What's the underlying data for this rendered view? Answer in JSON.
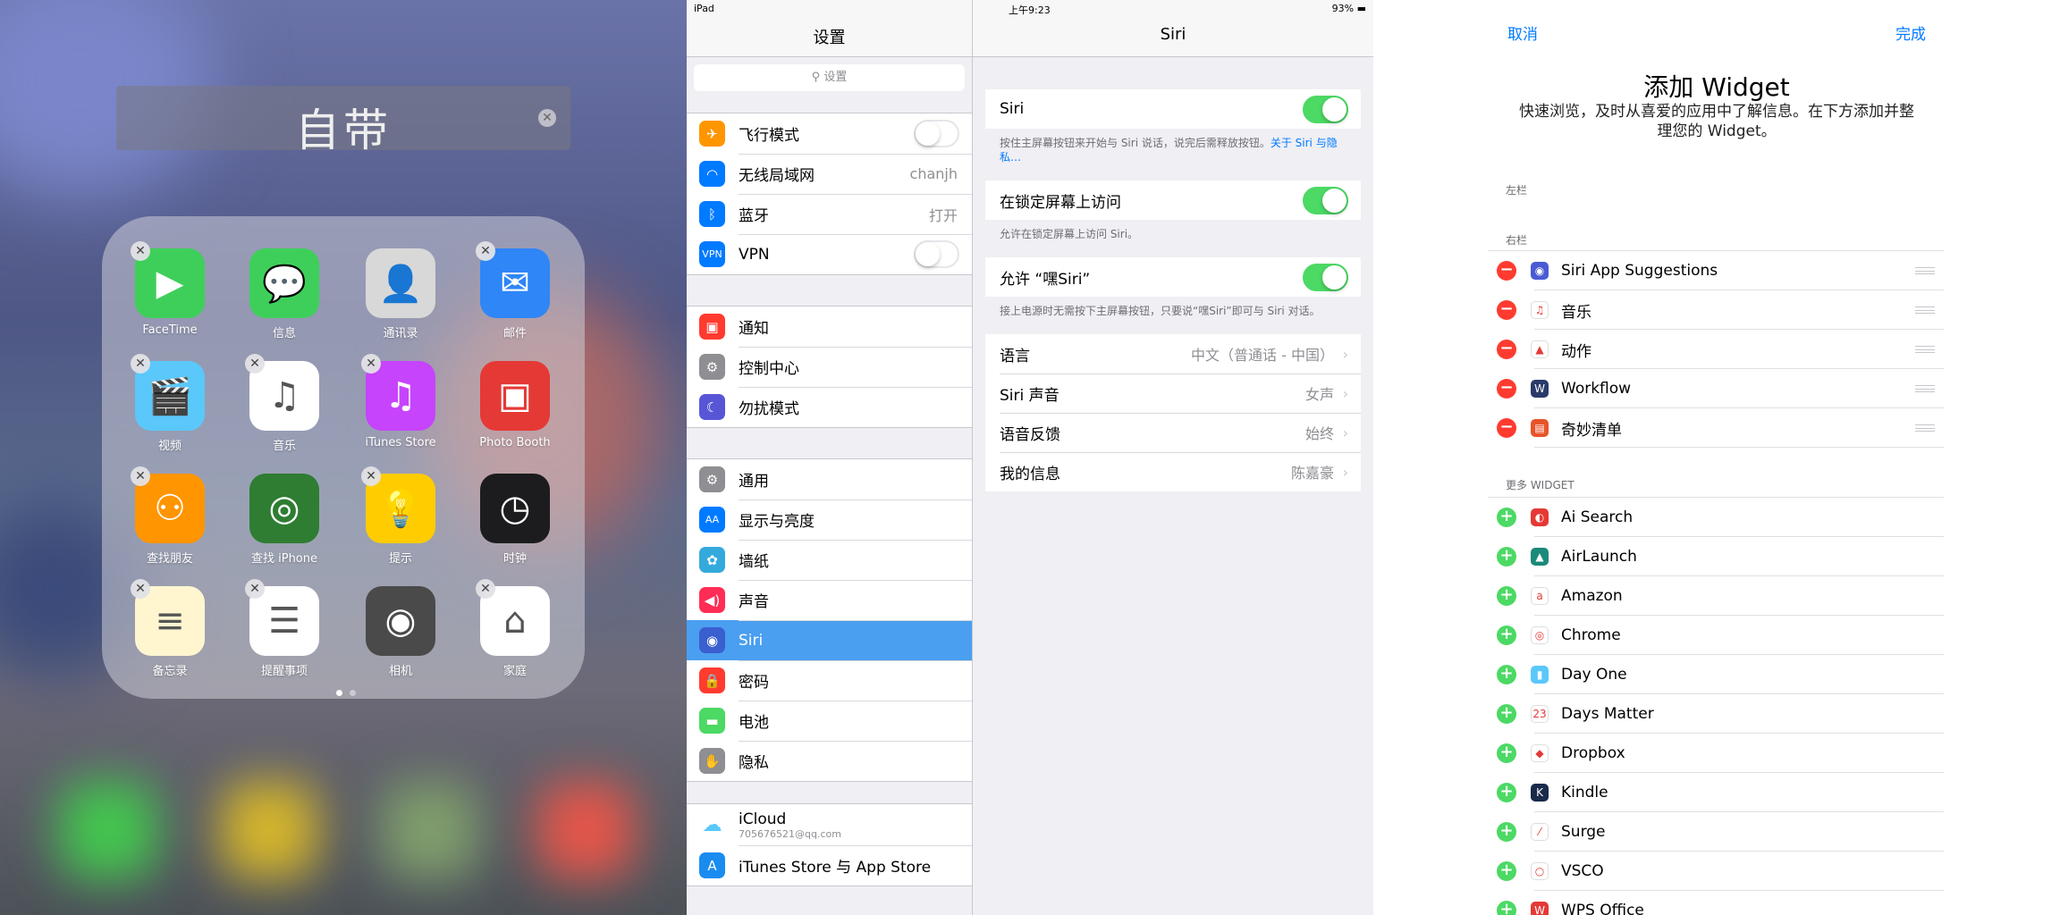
{
  "home": {
    "folder_title": "自带",
    "apps": [
      {
        "label": "FaceTime",
        "color": "#3ecf5a",
        "glyph": "▶"
      },
      {
        "label": "信息",
        "color": "#3ecf5a",
        "glyph": "💬"
      },
      {
        "label": "通讯录",
        "color": "#d8d8d8",
        "glyph": "👤"
      },
      {
        "label": "邮件",
        "color": "#2f86f6",
        "glyph": "✉"
      },
      {
        "label": "视频",
        "color": "#5ac8fa",
        "glyph": "🎬"
      },
      {
        "label": "音乐",
        "color": "#ffffff",
        "glyph": "♫"
      },
      {
        "label": "iTunes Store",
        "color": "#c644fc",
        "glyph": "♫"
      },
      {
        "label": "Photo Booth",
        "color": "#e53935",
        "glyph": "▣"
      },
      {
        "label": "查找朋友",
        "color": "#ff9500",
        "glyph": "⚇"
      },
      {
        "label": "查找 iPhone",
        "color": "#2e7d32",
        "glyph": "◎"
      },
      {
        "label": "提示",
        "color": "#ffcc00",
        "glyph": "💡"
      },
      {
        "label": "时钟",
        "color": "#1c1c1e",
        "glyph": "◷"
      },
      {
        "label": "备忘录",
        "color": "#fff6d0",
        "glyph": "≡"
      },
      {
        "label": "提醒事项",
        "color": "#ffffff",
        "glyph": "☰"
      },
      {
        "label": "相机",
        "color": "#4a4a4a",
        "glyph": "◉"
      },
      {
        "label": "家庭",
        "color": "#ffffff",
        "glyph": "⌂"
      }
    ]
  },
  "settings": {
    "status_left": "iPad",
    "status_time": "上午9:23",
    "status_right": "93%",
    "title": "设置",
    "search_placeholder": "设置",
    "groups": [
      [
        {
          "name": "飞行模式",
          "icon": "✈",
          "color": "#ff9500",
          "toggle": "off"
        },
        {
          "name": "无线局域网",
          "icon": "◠",
          "color": "#007aff",
          "value": "chanjh"
        },
        {
          "name": "蓝牙",
          "icon": "ᛒ",
          "color": "#007aff",
          "value": "打开"
        },
        {
          "name": "VPN",
          "icon": "VPN",
          "color": "#007aff",
          "toggle": "off"
        }
      ],
      [
        {
          "name": "通知",
          "icon": "▣",
          "color": "#ff3b30"
        },
        {
          "name": "控制中心",
          "icon": "⚙",
          "color": "#8e8e93"
        },
        {
          "name": "勿扰模式",
          "icon": "☾",
          "color": "#5856d6"
        }
      ],
      [
        {
          "name": "通用",
          "icon": "⚙",
          "color": "#8e8e93"
        },
        {
          "name": "显示与亮度",
          "icon": "AA",
          "color": "#007aff"
        },
        {
          "name": "墙纸",
          "icon": "✿",
          "color": "#34aadc"
        },
        {
          "name": "声音",
          "icon": "◀)",
          "color": "#ff2d55"
        },
        {
          "name": "Siri",
          "icon": "◉",
          "color": "#3a5fcf",
          "selected": true
        },
        {
          "name": "密码",
          "icon": "🔒",
          "color": "#ff3b30"
        },
        {
          "name": "电池",
          "icon": "▬",
          "color": "#4cd964"
        },
        {
          "name": "隐私",
          "icon": "✋",
          "color": "#8e8e93"
        }
      ]
    ],
    "icloud": {
      "name": "iCloud",
      "sub": "705676521@qq.com"
    },
    "itunes": {
      "name": "iTunes Store 与 App Store"
    },
    "detail": {
      "title": "Siri",
      "siri_label": "Siri",
      "siri_note": "按住主屏幕按钮来开始与 Siri 说话，说完后需释放按钮。",
      "siri_note_link": "关于 Siri 与隐私…",
      "lock_label": "在锁定屏幕上访问",
      "lock_note": "允许在锁定屏幕上访问 Siri。",
      "hey_label": "允许 “嘿Siri”",
      "hey_note": "接上电源时无需按下主屏幕按钮，只要说“嘿Siri”即可与 Siri 对话。",
      "rows": [
        {
          "label": "语言",
          "value": "中文（普通话 - 中国）"
        },
        {
          "label": "Siri 声音",
          "value": "女声"
        },
        {
          "label": "语音反馈",
          "value": "始终"
        },
        {
          "label": "我的信息",
          "value": "陈嘉豪"
        }
      ]
    }
  },
  "widgets": {
    "cancel": "取消",
    "done": "完成",
    "title": "添加 Widget",
    "desc": "快速浏览，及时从喜爱的应用中了解信息。在下方添加并整理您的 Widget。",
    "left_col": "左栏",
    "right_col": "右栏",
    "more": "更多 WIDGET",
    "active": [
      {
        "name": "Siri App Suggestions",
        "color": "#4a5bd4",
        "glyph": "◉"
      },
      {
        "name": "音乐",
        "color": "#ffffff",
        "glyph": "♫"
      },
      {
        "name": "动作",
        "color": "#ffffff",
        "glyph": "▲"
      },
      {
        "name": "Workflow",
        "color": "#2a3a6a",
        "glyph": "W"
      },
      {
        "name": "奇妙清单",
        "color": "#e8542a",
        "glyph": "▤"
      }
    ],
    "more_list": [
      {
        "name": "Ai Search",
        "color": "#e53935",
        "glyph": "◐"
      },
      {
        "name": "AirLaunch",
        "color": "#1b8a7a",
        "glyph": "▲"
      },
      {
        "name": "Amazon",
        "color": "#ffffff",
        "glyph": "a"
      },
      {
        "name": "Chrome",
        "color": "#ffffff",
        "glyph": "◎"
      },
      {
        "name": "Day One",
        "color": "#5ac8fa",
        "glyph": "▮"
      },
      {
        "name": "Days Matter",
        "color": "#ffffff",
        "glyph": "23"
      },
      {
        "name": "Dropbox",
        "color": "#ffffff",
        "glyph": "◆"
      },
      {
        "name": "Kindle",
        "color": "#1a2a4a",
        "glyph": "K"
      },
      {
        "name": "Surge",
        "color": "#ffffff",
        "glyph": "⁄"
      },
      {
        "name": "VSCO",
        "color": "#ffffff",
        "glyph": "○"
      },
      {
        "name": "WPS Office",
        "color": "#e53935",
        "glyph": "W"
      }
    ]
  }
}
